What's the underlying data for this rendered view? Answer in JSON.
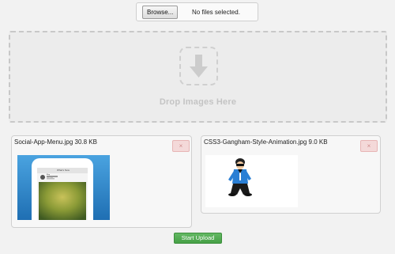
{
  "file_input": {
    "browse_label": "Browse...",
    "status": "No files selected."
  },
  "drop_zone": {
    "label": "Drop Images Here",
    "icon": "arrow-down-icon"
  },
  "files": [
    {
      "name": "Social-App-Menu.jpg",
      "size": "30.8 KB",
      "remove_label": "×",
      "preview_text": [
        "What's New",
        "Blog",
        "Just now"
      ]
    },
    {
      "name": "CSS3-Gangham-Style-Animation.jpg",
      "size": "9.0 KB",
      "remove_label": "×"
    }
  ],
  "actions": {
    "start_upload": "Start Upload"
  },
  "colors": {
    "accent_green": "#4cae4c",
    "remove_red_bg": "#f4d9d9",
    "drop_border": "#c8c8c8",
    "phone_bg": "#2e86c7"
  }
}
